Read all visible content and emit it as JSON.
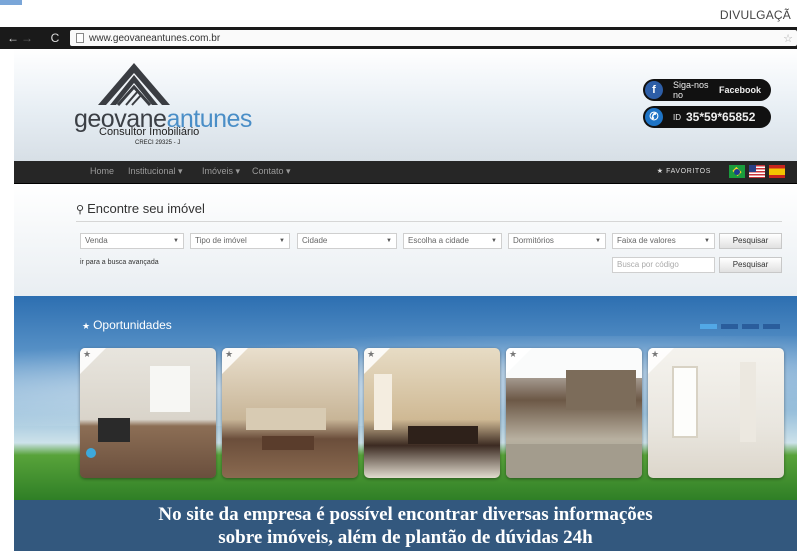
{
  "credit": "DIVULGAÇÃ",
  "browser": {
    "url": "www.geovaneantunes.com.br"
  },
  "header": {
    "logo_part1": "geovane",
    "logo_part2": "antunes",
    "subtitle": "Consultor Imobiliário",
    "creci": "CRECI 29325 - J",
    "facebook_text": "Siga-nos no",
    "facebook_bold": "Facebook",
    "phone_prefix": "ID",
    "phone_number": "35*59*65852"
  },
  "nav": {
    "items": [
      "Home",
      "Institucional ▾",
      "Imóveis ▾",
      "Contato ▾"
    ],
    "favorites": "★ FAVORITOS"
  },
  "search": {
    "title": "Encontre seu imóvel",
    "selects": [
      "Venda",
      "Tipo de imóvel",
      "Cidade",
      "Escolha a cidade",
      "Dormitórios",
      "Faixa de valores"
    ],
    "search_button": "Pesquisar",
    "advanced_link": "ir para a busca avançada",
    "code_placeholder": "Busca por código",
    "code_button": "Pesquisar"
  },
  "opportunities": {
    "title": "Oportunidades"
  },
  "caption": {
    "line1": "No site da empresa é possível encontrar diversas informações",
    "line2": "sobre imóveis, além de plantão de dúvidas 24h"
  },
  "colors": {
    "caption_bg": "#33587e",
    "nav_bg": "#262626",
    "accent": "#4a8ec7"
  }
}
